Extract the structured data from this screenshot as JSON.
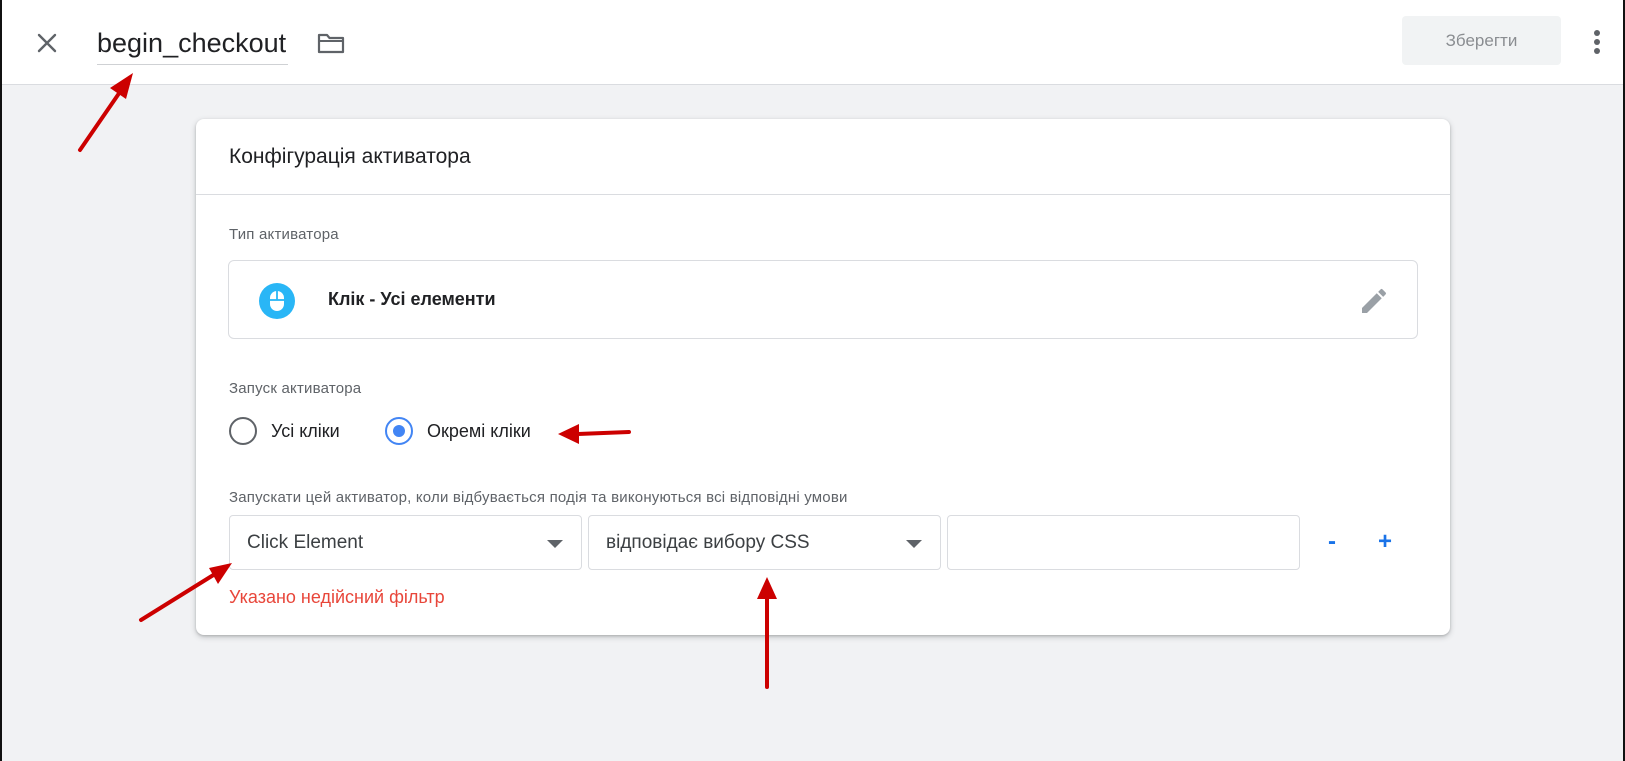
{
  "header": {
    "tag_name": "begin_checkout",
    "save_label": "Зберегти",
    "icons": {
      "close": "close-icon",
      "folder": "folder-icon",
      "more": "more-vert-icon"
    }
  },
  "card": {
    "title": "Конфігурація активатора",
    "trigger_type": {
      "label": "Тип активатора",
      "name": "Клік - Усі елементи",
      "icon": "mouse-icon",
      "icon_color": "#29b6f6"
    },
    "trigger_fires": {
      "label": "Запуск активатора",
      "options": [
        {
          "label": "Усі кліки",
          "checked": false
        },
        {
          "label": "Окремі кліки",
          "checked": true
        }
      ]
    },
    "conditions": {
      "label": "Запускати цей активатор, коли відбувається подія та виконуються всі відповідні умови",
      "variable": "Click Element",
      "operator": "відповідає вибору CSS",
      "value": "",
      "remove_label": "-",
      "add_label": "+",
      "error": "Указано недійсний фільтр"
    }
  },
  "colors": {
    "accent": "#4285f4",
    "link": "#1a73e8",
    "error": "#e8463a",
    "annotation_arrow": "#cc0000"
  }
}
